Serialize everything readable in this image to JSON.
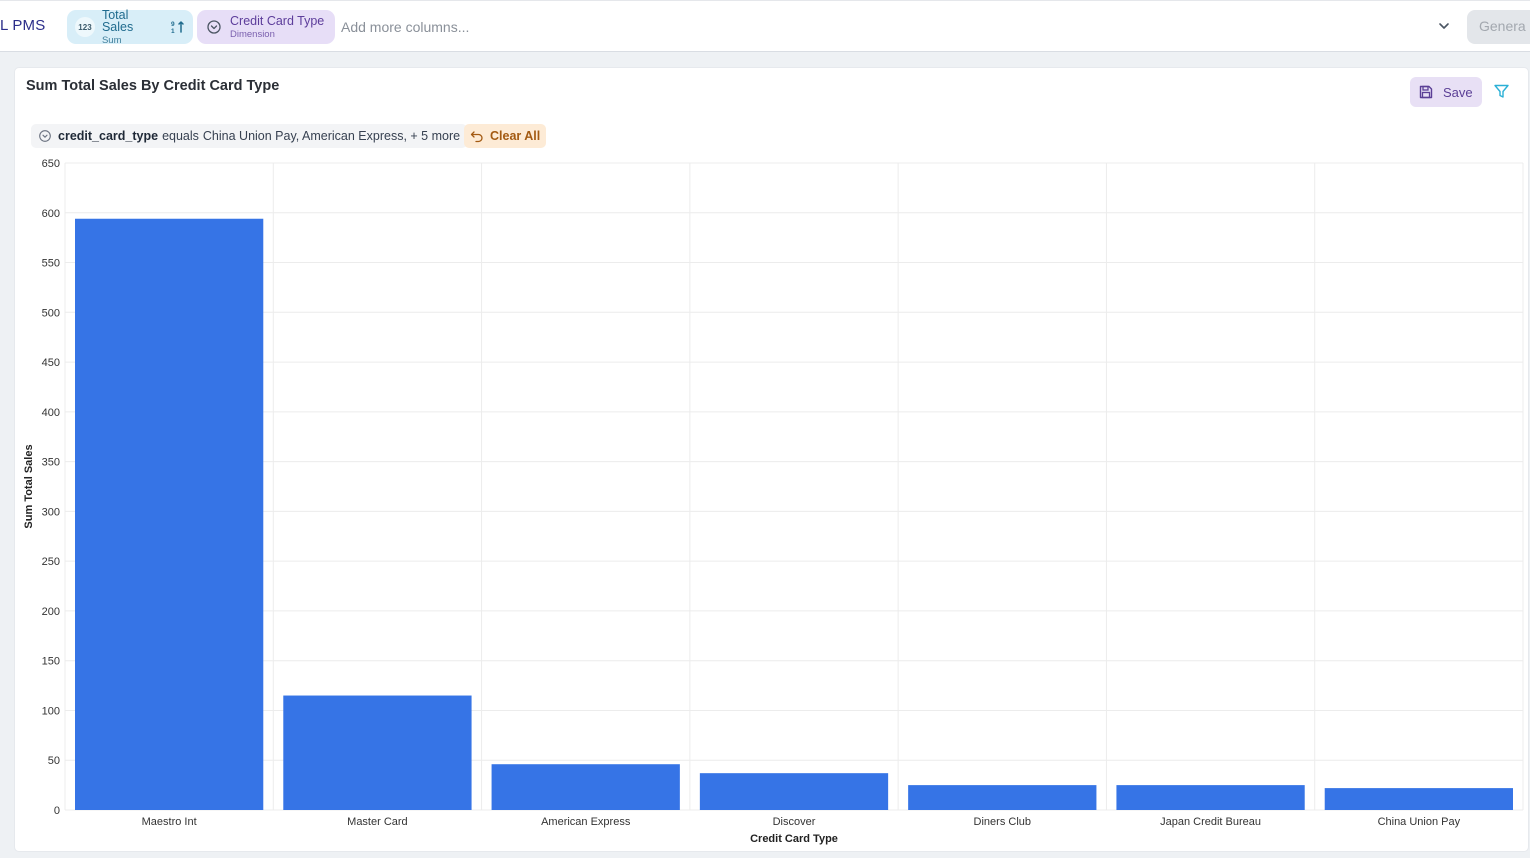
{
  "header": {
    "brand": "L PMS",
    "measure_pill": {
      "icon": "123",
      "label": "Total Sales",
      "sublabel": "Sum"
    },
    "dimension_pill": {
      "label": "Credit Card Type",
      "sublabel": "Dimension"
    },
    "add_columns_placeholder": "Add more columns...",
    "generate_label": "Genera"
  },
  "card": {
    "title": "Sum Total Sales By Credit Card Type",
    "save_label": "Save"
  },
  "filter": {
    "field": "credit_card_type",
    "operator": "equals",
    "values": "China Union Pay, American Express, + 5 more",
    "clear_label": "Clear All"
  },
  "colors": {
    "bar": "#3674e6",
    "accent_purple": "#5b3f96",
    "filter_icon": "#2bb0d6"
  },
  "chart_data": {
    "type": "bar",
    "title": "Sum Total Sales By Credit Card Type",
    "xlabel": "Credit Card Type",
    "ylabel": "Sum Total Sales",
    "categories": [
      "Maestro Int",
      "Master Card",
      "American Express",
      "Discover",
      "Diners Club",
      "Japan Credit Bureau",
      "China Union Pay"
    ],
    "values": [
      594,
      115,
      46,
      37,
      25,
      25,
      22
    ],
    "ylim": [
      0,
      650
    ],
    "yticks": [
      0,
      50,
      100,
      150,
      200,
      250,
      300,
      350,
      400,
      450,
      500,
      550,
      600,
      650
    ],
    "grid": true,
    "legend": "none"
  }
}
